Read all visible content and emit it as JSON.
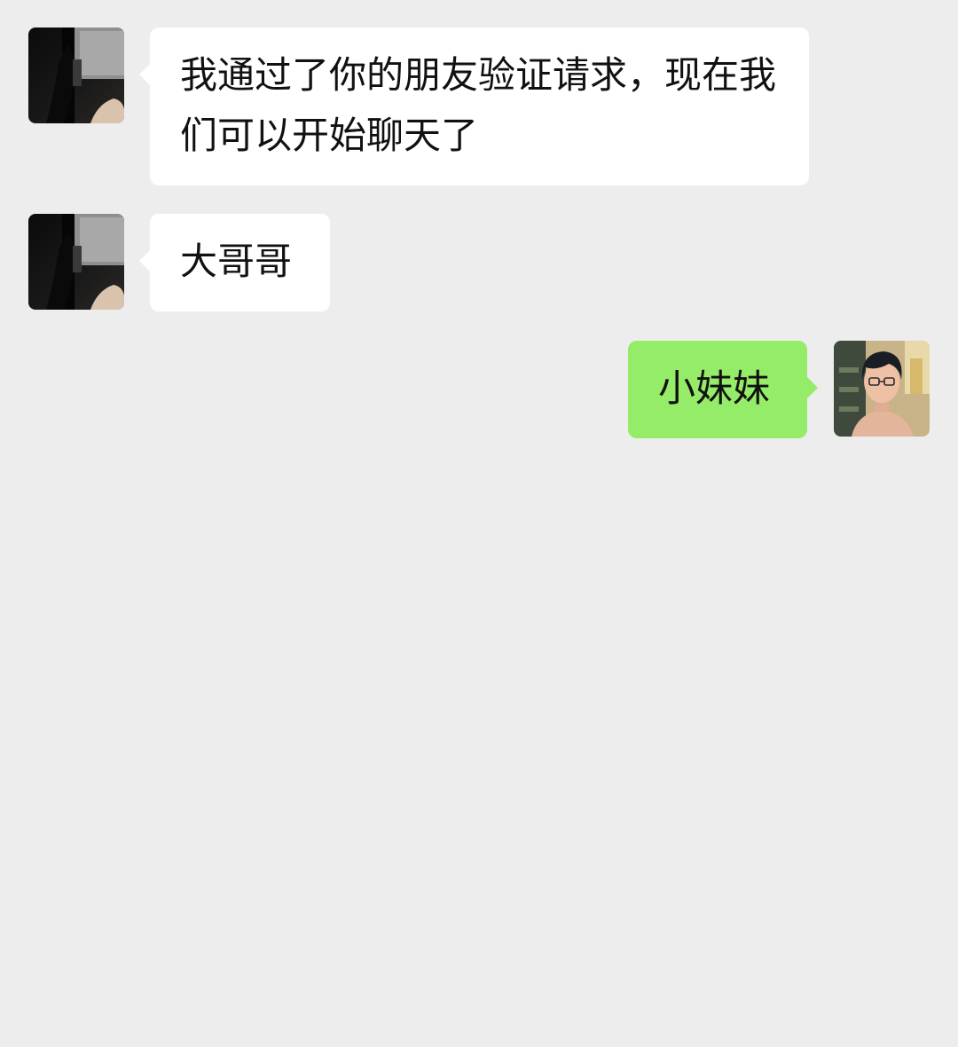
{
  "messages": [
    {
      "direction": "incoming",
      "avatar": "contact-avatar-photo",
      "text": "我通过了你的朋友验证请求，现在我们可以开始聊天了"
    },
    {
      "direction": "incoming",
      "avatar": "contact-avatar-photo",
      "text": "大哥哥"
    },
    {
      "direction": "outgoing",
      "avatar": "user-avatar-illustration",
      "text": "小妹妹"
    }
  ],
  "colors": {
    "background": "#ededed",
    "incoming_bubble": "#ffffff",
    "outgoing_bubble": "#95ec69",
    "text": "#111111"
  }
}
